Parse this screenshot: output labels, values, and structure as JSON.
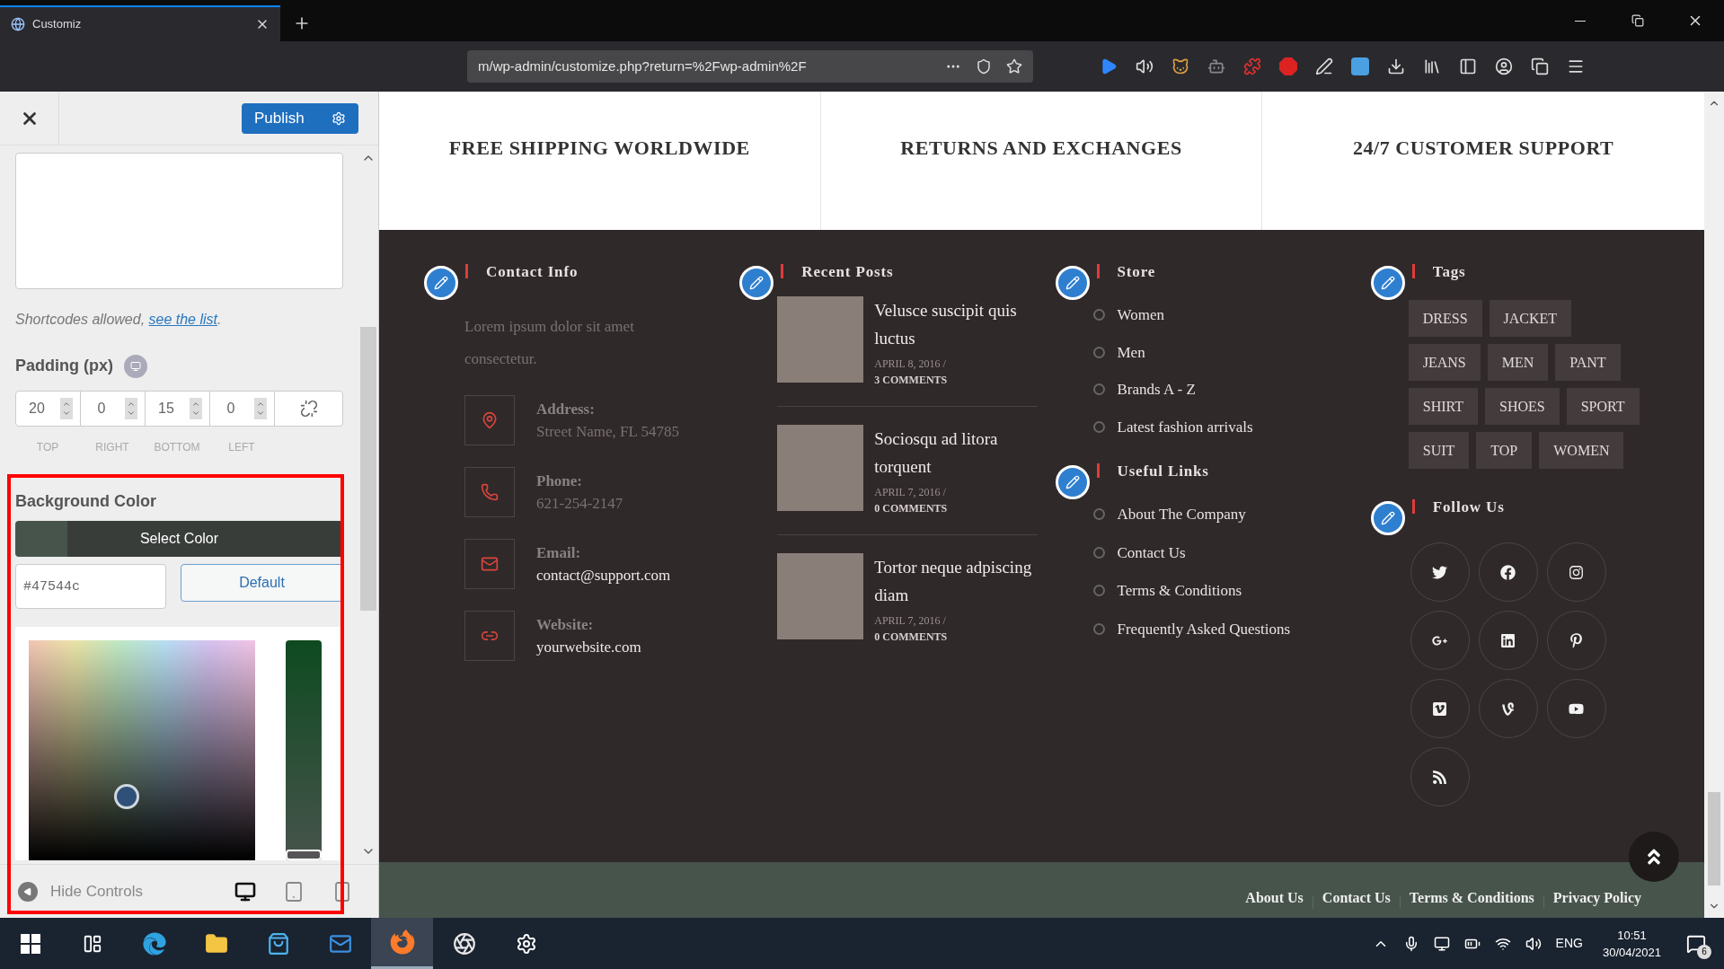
{
  "browser": {
    "tab_title": "Customiz",
    "url": "m/wp-admin/customize.php?return=%2Fwp-admin%2F"
  },
  "customizer": {
    "publish_button": "Publish",
    "shortcodes_note": "Shortcodes allowed, ",
    "shortcodes_link": "see the list",
    "shortcodes_end": ".",
    "padding": {
      "label": "Padding (px)",
      "fields": [
        {
          "value": "20",
          "label": "TOP"
        },
        {
          "value": "0",
          "label": "RIGHT"
        },
        {
          "value": "15",
          "label": "BOTTOM"
        },
        {
          "value": "0",
          "label": "LEFT"
        }
      ]
    },
    "background_color": {
      "label": "Background Color",
      "select_button": "Select Color",
      "hex_value": "#47544c",
      "default_button": "Default"
    },
    "hue_slider": {
      "level": 0
    },
    "hide_controls": "Hide Controls",
    "devices": [
      {
        "kind": "desktop",
        "selected": true
      },
      {
        "kind": "tablet",
        "selected": false
      },
      {
        "kind": "mobile",
        "selected": false
      }
    ]
  },
  "preview": {
    "features": [
      "FREE SHIPPING WORLDWIDE",
      "RETURNS AND EXCHANGES",
      "24/7 CUSTOMER SUPPORT"
    ],
    "contact": {
      "heading": "Contact Info",
      "intro": "Lorem ipsum dolor sit amet consectetur.",
      "items": [
        {
          "kind": "address",
          "label": "Address:",
          "value": "Street Name, FL 54785",
          "dimmed": true
        },
        {
          "kind": "phone",
          "label": "Phone:",
          "value": "621-254-2147",
          "dimmed": true
        },
        {
          "kind": "email",
          "label": "Email:",
          "value": "contact@support.com",
          "dimmed": false
        },
        {
          "kind": "website",
          "label": "Website:",
          "value": "yourwebsite.com",
          "dimmed": false
        }
      ]
    },
    "recent_posts": {
      "heading": "Recent Posts",
      "posts": [
        {
          "title": "Velusce suscipit quis luctus",
          "date": "APRIL 8, 2016 /",
          "comments": "3 COMMENTS"
        },
        {
          "title": "Sociosqu ad litora torquent",
          "date": "APRIL 7, 2016 /",
          "comments": "0 COMMENTS"
        },
        {
          "title": "Tortor neque adpiscing diam",
          "date": "APRIL 7, 2016 /",
          "comments": "0 COMMENTS"
        }
      ]
    },
    "store": {
      "heading": "Store",
      "links": [
        "Women",
        "Men",
        "Brands A - Z",
        "Latest fashion arrivals"
      ]
    },
    "useful_links": {
      "heading": "Useful Links",
      "links": [
        "About The Company",
        "Contact Us",
        "Terms & Conditions",
        "Frequently Asked Questions"
      ]
    },
    "tags": {
      "heading": "Tags",
      "rows": [
        [
          "DRESS",
          "JACKET"
        ],
        [
          "JEANS",
          "MEN",
          "PANT"
        ],
        [
          "SHIRT",
          "SHOES",
          "SPORT"
        ],
        [
          "SUIT",
          "TOP",
          "WOMEN"
        ]
      ]
    },
    "follow": {
      "heading": "Follow Us",
      "networks": [
        {
          "kind": "twitter"
        },
        {
          "kind": "facebook"
        },
        {
          "kind": "instagram"
        },
        {
          "kind": "googleplus"
        },
        {
          "kind": "linkedin"
        },
        {
          "kind": "pinterest"
        },
        {
          "kind": "vimeo"
        },
        {
          "kind": "vine"
        },
        {
          "kind": "youtube"
        },
        {
          "kind": "rss"
        }
      ]
    },
    "bottom_links": [
      "About Us",
      "Contact Us",
      "Terms & Conditions",
      "Privacy Policy"
    ]
  },
  "taskbar": {
    "apps": [
      {
        "kind": "taskview",
        "active": false
      },
      {
        "kind": "edge",
        "active": false
      },
      {
        "kind": "files",
        "active": false
      },
      {
        "kind": "store",
        "active": false
      },
      {
        "kind": "mail",
        "active": false
      },
      {
        "kind": "firefox",
        "active": true
      },
      {
        "kind": "obs",
        "active": false
      },
      {
        "kind": "settings",
        "active": false
      }
    ],
    "language": "ENG",
    "time": "10:51",
    "date": "30/04/2021",
    "notifications": "6"
  }
}
